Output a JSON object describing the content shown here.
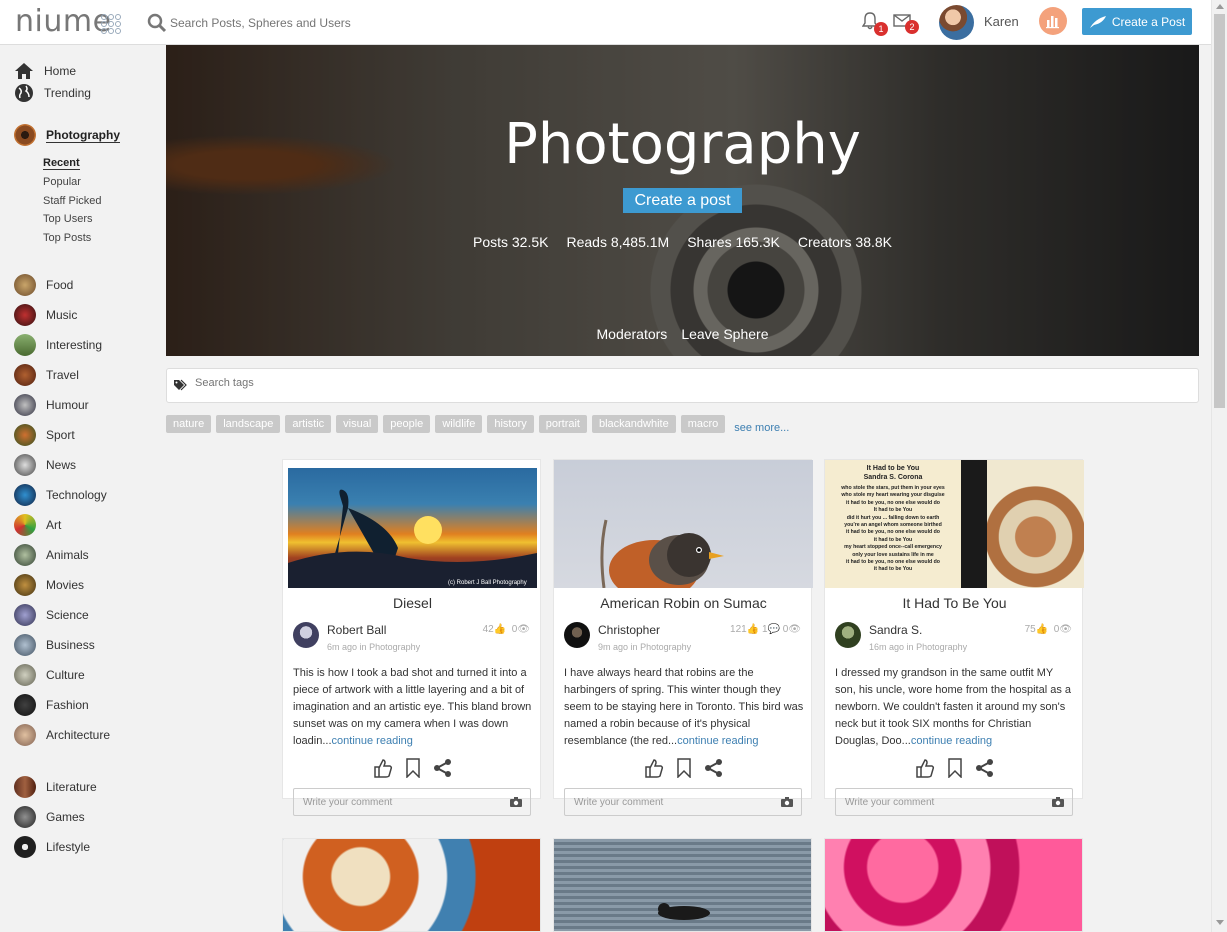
{
  "topbar": {
    "logo": "niume",
    "search_placeholder": "Search Posts, Spheres and Users",
    "notifications_count": "1",
    "messages_count": "2",
    "username": "Karen",
    "create_post_label": "Create a Post"
  },
  "sidebar": {
    "main": [
      {
        "label": "Home",
        "icon": "home-icon"
      },
      {
        "label": "Trending",
        "icon": "globe-icon"
      }
    ],
    "current_sphere": "Photography",
    "sub": [
      "Recent",
      "Popular",
      "Staff Picked",
      "Top Users",
      "Top Posts"
    ],
    "spheres": [
      "Food",
      "Music",
      "Interesting",
      "Travel",
      "Humour",
      "Sport",
      "News",
      "Technology",
      "Art",
      "Animals",
      "Movies",
      "Science",
      "Business",
      "Culture",
      "Fashion",
      "Architecture"
    ],
    "spheres2": [
      "Literature",
      "Games",
      "Lifestyle"
    ]
  },
  "hero": {
    "title": "Photography",
    "create_label": "Create a post",
    "stats": [
      {
        "label": "Posts",
        "value": "32.5K"
      },
      {
        "label": "Reads",
        "value": "8,485.1M"
      },
      {
        "label": "Shares",
        "value": "165.3K"
      },
      {
        "label": "Creators",
        "value": "38.8K"
      }
    ],
    "moderators_label": "Moderators",
    "leave_label": "Leave Sphere"
  },
  "tag_search_placeholder": "Search tags",
  "tags": [
    "nature",
    "landscape",
    "artistic",
    "visual",
    "people",
    "wildlife",
    "history",
    "portrait",
    "blackandwhite",
    "macro"
  ],
  "see_more": "see more...",
  "cards": [
    {
      "title": "Diesel",
      "author": "Robert Ball",
      "time": "6m ago",
      "sphere": "Photography",
      "likes": "42",
      "comments": "",
      "views": "0",
      "excerpt": "This is how I took a bad shot and turned it into a piece of artwork with a little layering and a bit of imagination and an artistic eye. This bland brown sunset was on my camera when I was down loadin...",
      "more": "continue reading",
      "comment_placeholder": "Write your comment"
    },
    {
      "title": "American Robin on Sumac",
      "author": "Christopher",
      "time": "9m ago",
      "sphere": "Photography",
      "likes": "121",
      "comments": "1",
      "views": "0",
      "excerpt": "I have always heard that robins are the harbingers of spring. This winter though they seem to be staying here in Toronto. This bird was named a robin because of it's physical resemblance (the red...",
      "more": "continue reading",
      "comment_placeholder": "Write your comment"
    },
    {
      "title": "It Had To Be You",
      "author": "Sandra S.",
      "time": "16m ago",
      "sphere": "Photography",
      "likes": "75",
      "comments": "",
      "views": "0",
      "excerpt": "I dressed my grandson in the same outfit MY son, his uncle, wore home from the hospital as a newborn.  We couldn't fasten it around my son's neck but it took SIX months for Christian Douglas, Doo...",
      "more": "continue reading",
      "comment_placeholder": "Write your comment"
    }
  ],
  "poem": {
    "title": "It Had to be You",
    "byline": "Sandra S. Corona",
    "lines": [
      "who stole the stars, put them in your eyes",
      "who stole my heart wearing your disguise",
      "it had to be you, no one else would do",
      "It had to be You",
      "did it hurt you ... falling down to earth",
      "you're an angel whom someone birthed",
      "it had to be you, no one else would do",
      "it had to be You",
      "my heart stopped once--call emergency",
      "only your love sustains life in me",
      "it had to be you, no one else would do",
      "it had to be You"
    ]
  },
  "image_credit": "(c) Robert J Ball Photography",
  "in_label": "in",
  "colors": {
    "accent": "#3d9ad1",
    "badge": "#d9302e",
    "link": "#3d7fb1"
  }
}
